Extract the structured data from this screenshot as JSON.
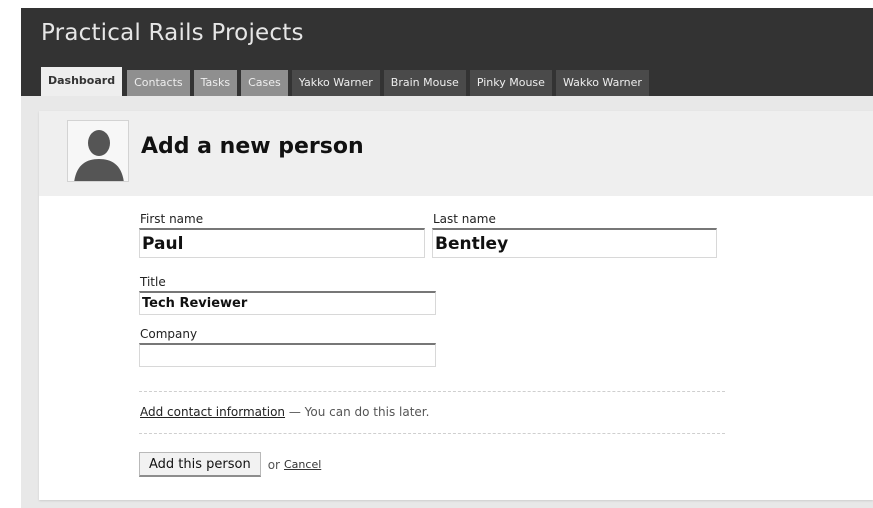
{
  "app": {
    "title": "Practical Rails Projects"
  },
  "tabs": [
    {
      "label": "Dashboard",
      "active": true
    },
    {
      "label": "Contacts"
    },
    {
      "label": "Tasks"
    },
    {
      "label": "Cases"
    },
    {
      "label": "Yakko Warner"
    },
    {
      "label": "Brain Mouse"
    },
    {
      "label": "Pinky Mouse"
    },
    {
      "label": "Wakko Warner"
    }
  ],
  "panel": {
    "title": "Add a new person",
    "avatar_icon": "person-silhouette-icon"
  },
  "form": {
    "first_name": {
      "label": "First name",
      "value": "Paul"
    },
    "last_name": {
      "label": "Last name",
      "value": "Bentley"
    },
    "title": {
      "label": "Title",
      "value": "Tech Reviewer"
    },
    "company": {
      "label": "Company",
      "value": ""
    },
    "add_contact_link": "Add contact information",
    "add_contact_note": " — You can do this later.",
    "submit_label": "Add this person",
    "or_text": "or",
    "cancel_label": "Cancel"
  },
  "colors": {
    "header_bg": "#333333",
    "title_text": "#e6e6e6",
    "active_tab_bg": "#eeeeee",
    "gray_tab_bg": "#8f8f8f",
    "dark_tab_bg": "#4a4a4a",
    "page_bg": "#e8e8e8",
    "panel_header_bg": "#efefef"
  }
}
